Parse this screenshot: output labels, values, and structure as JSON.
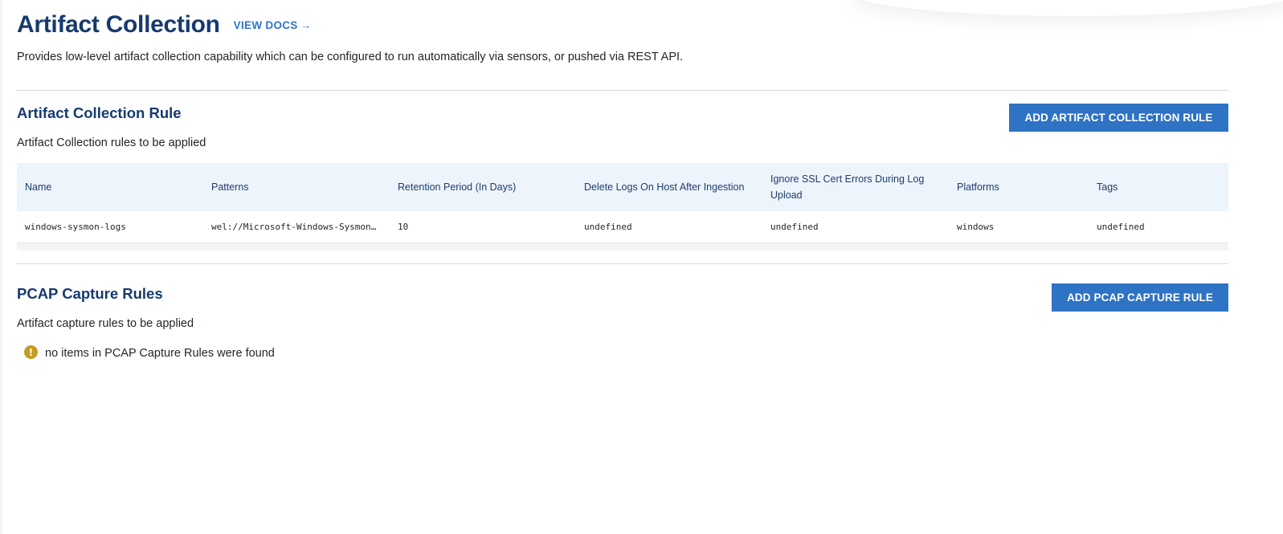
{
  "header": {
    "title": "Artifact Collection",
    "docs_link": "VIEW DOCS",
    "docs_arrow": "→",
    "description": "Provides low-level artifact collection capability which can be configured to run automatically via sensors, or pushed via REST API."
  },
  "artifact_section": {
    "title": "Artifact Collection Rule",
    "description": "Artifact Collection rules to be applied",
    "add_button": "ADD ARTIFACT COLLECTION RULE",
    "columns": [
      "Name",
      "Patterns",
      "Retention Period (In Days)",
      "Delete Logs On Host After Ingestion",
      "Ignore SSL Cert Errors During Log Upload",
      "Platforms",
      "Tags"
    ],
    "rows": [
      [
        "windows-sysmon-logs",
        "wel://Microsoft-Windows-Sysmon/Operational:*",
        "10",
        "undefined",
        "undefined",
        "windows",
        "undefined"
      ]
    ]
  },
  "pcap_section": {
    "title": "PCAP Capture Rules",
    "description": "Artifact capture rules to be applied",
    "add_button": "ADD PCAP CAPTURE RULE",
    "empty_icon": "!",
    "empty_message": "no items in PCAP Capture Rules were found"
  },
  "colors": {
    "title": "#163a6e",
    "link": "#2f76c9",
    "button": "#2e73c4",
    "table_header_bg": "#eef4fc",
    "warning": "#c89a1e"
  }
}
